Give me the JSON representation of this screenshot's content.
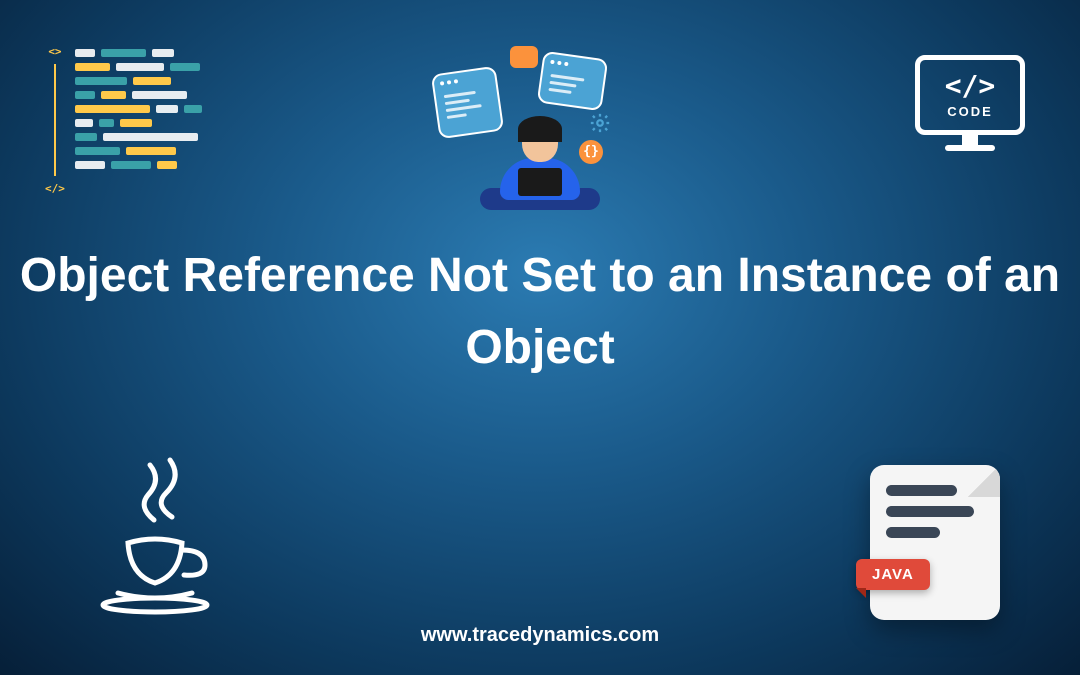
{
  "title": "Object Reference Not Set to an Instance of an Object",
  "footer_url": "www.tracedynamics.com",
  "monitor": {
    "brackets": "</>",
    "label": "CODE"
  },
  "java_file": {
    "tag": "JAVA"
  },
  "dev": {
    "braces": "{}"
  },
  "code_gutter": {
    "open": "<>",
    "close": "</>"
  }
}
